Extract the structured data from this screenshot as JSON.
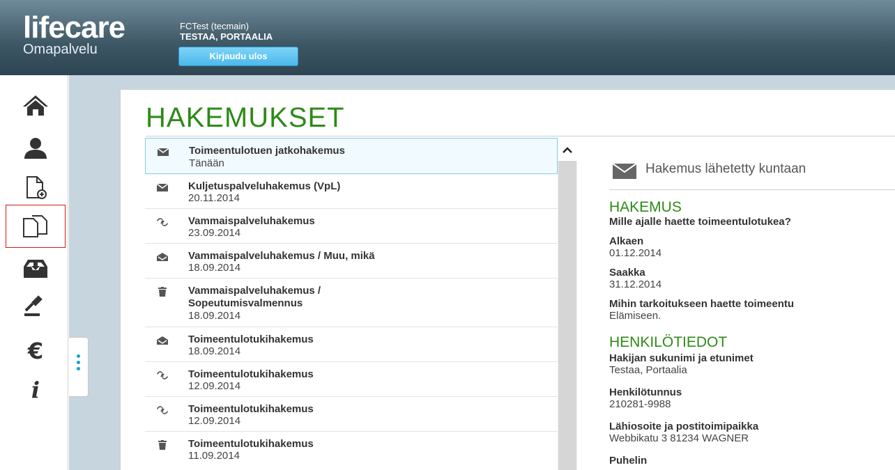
{
  "header": {
    "logo_main": "lifecare",
    "logo_sub": "Omapalvelu",
    "user_line1": "FCTest (tecmain)",
    "user_line2": "TESTAA, PORTAALIA",
    "logout_label": "Kirjaudu ulos"
  },
  "nav": {
    "items": [
      {
        "name": "home-icon"
      },
      {
        "name": "person-icon"
      },
      {
        "name": "new-document-icon"
      },
      {
        "name": "documents-icon",
        "active": true
      },
      {
        "name": "inbox-download-icon"
      },
      {
        "name": "gavel-icon"
      },
      {
        "name": "euro-icon"
      },
      {
        "name": "info-icon"
      }
    ]
  },
  "page": {
    "title": "HAKEMUKSET"
  },
  "list": {
    "items": [
      {
        "icon": "envelope-icon",
        "title": "Toimeentulotuen jatkohakemus",
        "date": "Tänään"
      },
      {
        "icon": "envelope-icon",
        "title": "Kuljetuspalveluhakemus (VpL)",
        "date": "20.11.2014"
      },
      {
        "icon": "exchange-icon",
        "title": "Vammaispalveluhakemus",
        "date": "23.09.2014"
      },
      {
        "icon": "open-envelope-icon",
        "title": "Vammaispalveluhakemus / Muu, mikä",
        "date": "18.09.2014"
      },
      {
        "icon": "trash-icon",
        "title": "Vammaispalveluhakemus /",
        "title2": "Sopeutumisvalmennus",
        "date": "18.09.2014"
      },
      {
        "icon": "open-envelope-icon",
        "title": "Toimeentulotukihakemus",
        "date": "18.09.2014"
      },
      {
        "icon": "exchange-icon",
        "title": "Toimeentulotukihakemus",
        "date": "12.09.2014"
      },
      {
        "icon": "exchange-icon",
        "title": "Toimeentulotukihakemus",
        "date": "12.09.2014"
      },
      {
        "icon": "trash-icon",
        "title": "Toimeentulotukihakemus",
        "date": "11.09.2014"
      }
    ]
  },
  "detail": {
    "status": "Hakemus lähetetty kuntaan",
    "section1_title": "HAKEMUS",
    "q_period": "Mille ajalle haette toimeentulotukea?",
    "label_start": "Alkaen",
    "value_start": "01.12.2014",
    "label_end": "Saakka",
    "value_end": "31.12.2014",
    "q_purpose": "Mihin tarkoitukseen haette toimeentu",
    "value_purpose": "Elämiseen.",
    "section2_title": "HENKILÖTIEDOT",
    "label_name": "Hakijan sukunimi ja etunimet",
    "value_name": "Testaa, Portaalia",
    "label_ssn": "Henkilötunnus",
    "value_ssn": "210281-9988",
    "label_address": "Lähiosoite ja postitoimipaikka",
    "value_address": "Webbikatu 3 81234 WAGNER",
    "label_phone": "Puhelin"
  }
}
